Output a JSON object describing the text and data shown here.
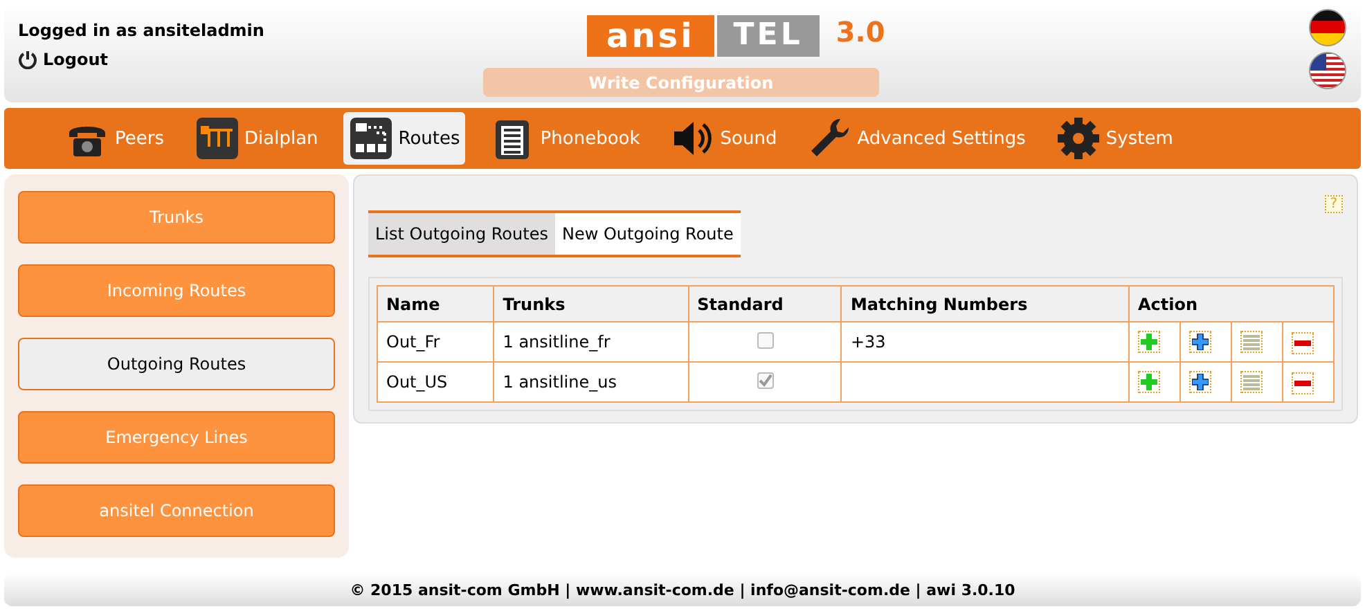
{
  "header": {
    "user_label": "Logged in as ansiteladmin",
    "logout": "Logout",
    "logo": {
      "part_1": "ansi",
      "part_2": "TEL",
      "version": "3.0"
    },
    "write_button": "Write Configuration",
    "languages": [
      {
        "kind": "de"
      },
      {
        "kind": "us"
      }
    ]
  },
  "nav": [
    {
      "label": "Peers",
      "kind": "phone",
      "selected": false
    },
    {
      "label": "Dialplan",
      "kind": "dialplan",
      "selected": false
    },
    {
      "label": "Routes",
      "kind": "routes",
      "selected": true
    },
    {
      "label": "Phonebook",
      "kind": "book",
      "selected": false
    },
    {
      "label": "Sound",
      "kind": "sound",
      "selected": false
    },
    {
      "label": "Advanced Settings",
      "kind": "wrench",
      "selected": false
    },
    {
      "label": "System",
      "kind": "gear",
      "selected": false
    }
  ],
  "sidebar": {
    "items": [
      {
        "label": "Trunks",
        "selected": false
      },
      {
        "label": "Incoming Routes",
        "selected": false
      },
      {
        "label": "Outgoing Routes",
        "selected": true
      },
      {
        "label": "Emergency Lines",
        "selected": false
      },
      {
        "label": "ansitel Connection",
        "selected": false
      }
    ]
  },
  "help": "?",
  "tabs": [
    {
      "label": "List Outgoing Routes",
      "selected": true
    },
    {
      "label": "New Outgoing Route",
      "selected": false
    }
  ],
  "table": {
    "columns": [
      "Name",
      "Trunks",
      "Standard",
      "Matching Numbers",
      "Action"
    ],
    "rows": [
      {
        "name": "Out_Fr",
        "trunks": "1 ansitline_fr",
        "standard": false,
        "matching": "+33",
        "actions": [
          {
            "kind": "add"
          },
          {
            "kind": "copy"
          },
          {
            "kind": "list"
          },
          {
            "kind": "delete"
          }
        ]
      },
      {
        "name": "Out_US",
        "trunks": "1 ansitline_us",
        "standard": true,
        "actions": [
          {
            "kind": "add"
          },
          {
            "kind": "copy"
          },
          {
            "kind": "list"
          },
          {
            "kind": "delete"
          }
        ]
      }
    ]
  },
  "footer": "© 2015 ansit-com GmbH | www.ansit-com.de | info@ansit-com.de | awi 3.0.10"
}
